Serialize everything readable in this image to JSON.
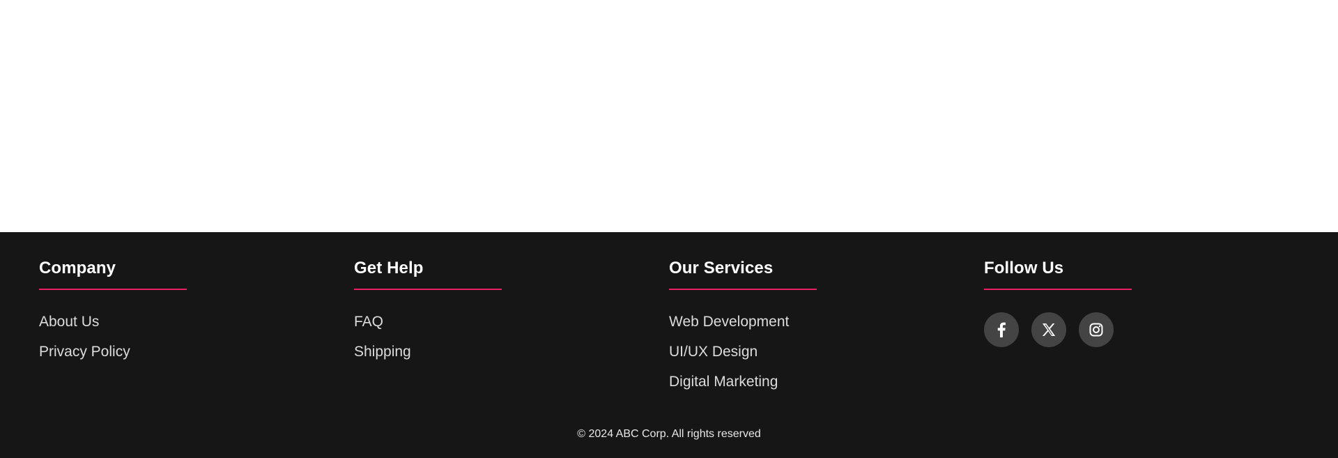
{
  "footer": {
    "columns": [
      {
        "title": "Company",
        "links": [
          "About Us",
          "Privacy Policy"
        ]
      },
      {
        "title": "Get Help",
        "links": [
          "FAQ",
          "Shipping"
        ]
      },
      {
        "title": "Our Services",
        "links": [
          "Web Development",
          "UI/UX Design",
          "Digital Marketing"
        ]
      },
      {
        "title": "Follow Us"
      }
    ],
    "social": [
      {
        "icon": "facebook-icon"
      },
      {
        "icon": "x-twitter-icon"
      },
      {
        "icon": "instagram-icon"
      }
    ],
    "copyright": "© 2024 ABC Corp. All rights reserved"
  },
  "colors": {
    "footer_background": "#161616",
    "accent": "#e91e63",
    "social_button": "#444444"
  }
}
